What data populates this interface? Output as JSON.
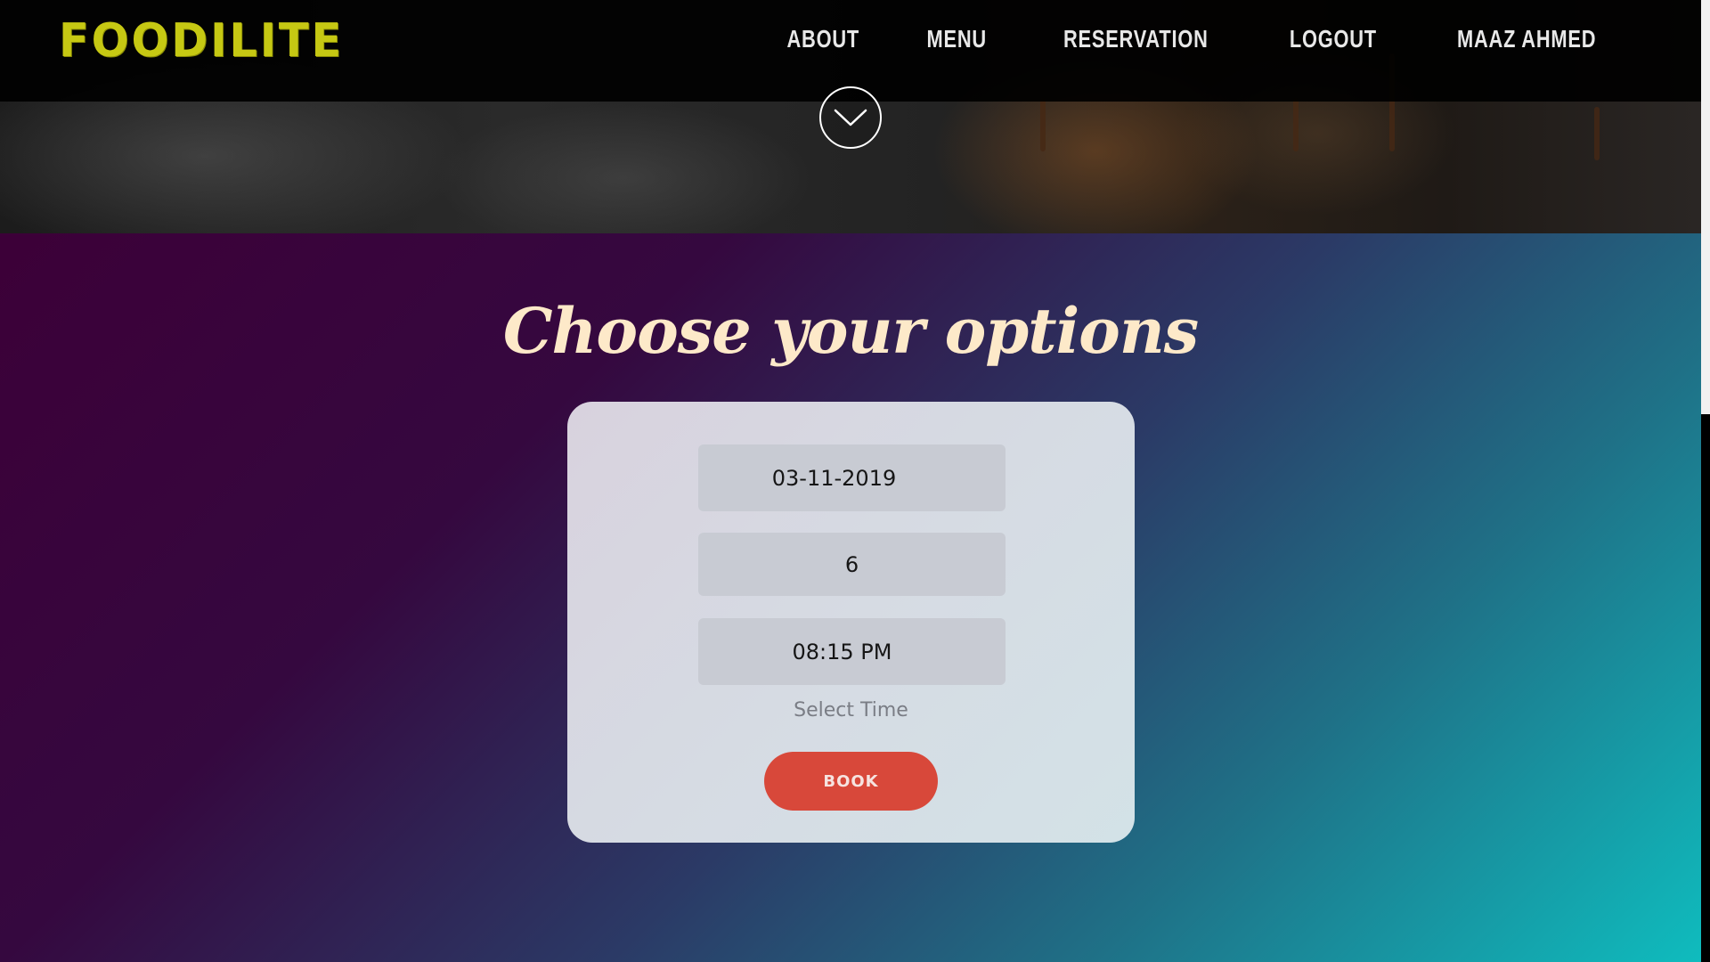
{
  "header": {
    "brand": "FOODILITE",
    "nav": [
      {
        "label": "ABOUT"
      },
      {
        "label": "MENU"
      },
      {
        "label": "RESERVATION"
      },
      {
        "label": "LOGOUT"
      },
      {
        "label": "MAAZ AHMED"
      }
    ],
    "scroll_icon": "chevron-down-icon"
  },
  "section": {
    "title": "Choose your options"
  },
  "form": {
    "date_value": "03-11-2019",
    "guests_value": "6",
    "time_value": "08:15 PM",
    "time_hint": "Select Time",
    "book_label": "BOOK"
  },
  "colors": {
    "brand": "#c6c813",
    "title": "#fde9c9",
    "button": "#d8483a",
    "gradient_start": "#3c0038",
    "gradient_end": "#0fbcbe"
  }
}
